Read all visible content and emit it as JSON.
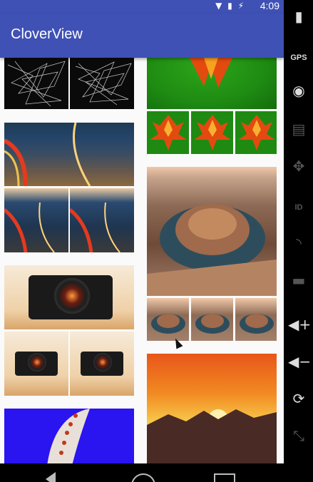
{
  "status_bar": {
    "time": "4:09",
    "icons": "▼ ▮ ⚡"
  },
  "app_bar": {
    "title": "CloverView"
  },
  "emulator_toolbar": {
    "gps_label": "GPS",
    "id_label": "ID"
  },
  "colors": {
    "primary": "#3f51b5",
    "background": "#fafafa"
  },
  "images": [
    "network-lines",
    "city-night",
    "camera",
    "jellyfish",
    "autumn-leaf",
    "horseshoe-bend",
    "sunset-mountains"
  ]
}
